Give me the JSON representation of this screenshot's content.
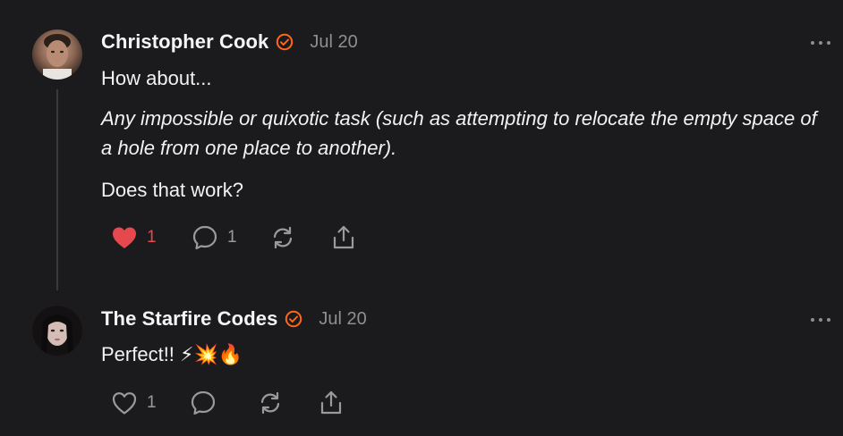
{
  "colors": {
    "background": "#1b1b1d",
    "accent": "#ff6719",
    "like": "#e5484d",
    "muted": "#8e8e93"
  },
  "comments": [
    {
      "author": "Christopher Cook",
      "verified": true,
      "date": "Jul 20",
      "paragraphs": [
        "How about...",
        "Any impossible or quixotic task (such as attempting to relocate the empty space of a hole from one place to another).",
        "Does that work?"
      ],
      "liked": true,
      "likes": "1",
      "replies": "1",
      "icons": [
        "heart-icon",
        "comment-icon",
        "restack-icon",
        "share-icon",
        "more-icon"
      ]
    },
    {
      "author": "The Starfire Codes",
      "verified": true,
      "date": "Jul 20",
      "paragraphs": [
        "Perfect!! ⚡💥🔥"
      ],
      "liked": false,
      "likes": "1",
      "icons": [
        "heart-icon",
        "comment-icon",
        "restack-icon",
        "share-icon",
        "more-icon"
      ]
    }
  ]
}
